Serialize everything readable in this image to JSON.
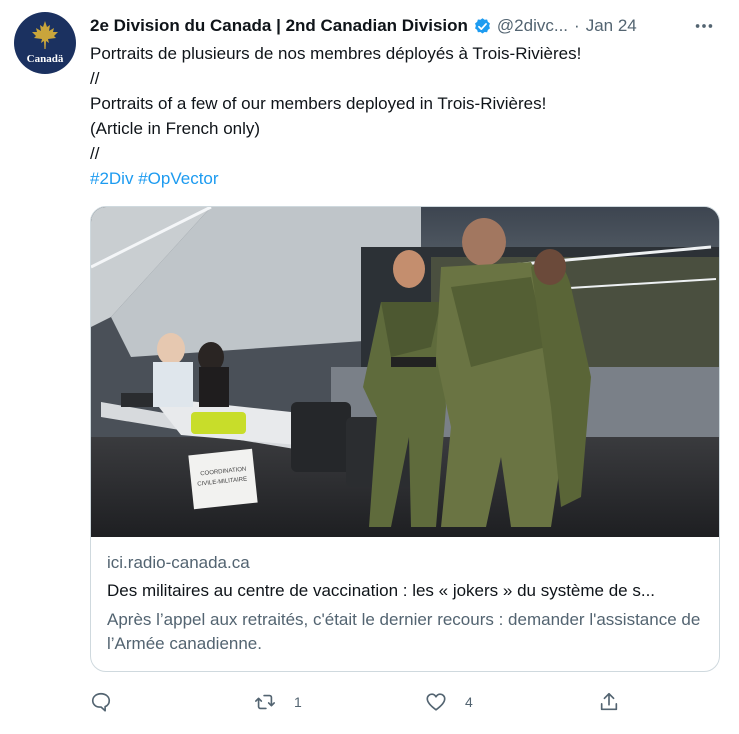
{
  "tweet": {
    "avatar_text": "Canadä",
    "author_name": "2e Division du Canada | 2nd Canadian Division",
    "handle": "@2divc...",
    "separator": "·",
    "date": "Jan 24",
    "text_lines": [
      "Portraits de plusieurs de nos membres déployés à Trois-Rivières!",
      "//",
      "Portraits of a few of our members deployed in Trois-Rivières!",
      "(Article in French only)",
      "//"
    ],
    "hashtags": [
      "#2Div",
      "#OpVector"
    ]
  },
  "card": {
    "domain": "ici.radio-canada.ca",
    "title": "Des militaires au centre de vaccination : les « jokers » du système de s...",
    "description": "Après l’appel aux retraités, c'était le dernier recours : demander l'assistance de l’Armée canadienne.",
    "sign_text_1": "COORDINATION",
    "sign_text_2": "CIVILE-MILITAIRE"
  },
  "actions": {
    "reply_count": "",
    "retweet_count": "1",
    "like_count": "4",
    "share_count": ""
  },
  "colors": {
    "text": "#0f1419",
    "secondary": "#536471",
    "accent": "#1d9bf0",
    "border": "#cfd9de",
    "avatar_bg": "#1b3160",
    "avatar_leaf": "#c9a53b"
  }
}
